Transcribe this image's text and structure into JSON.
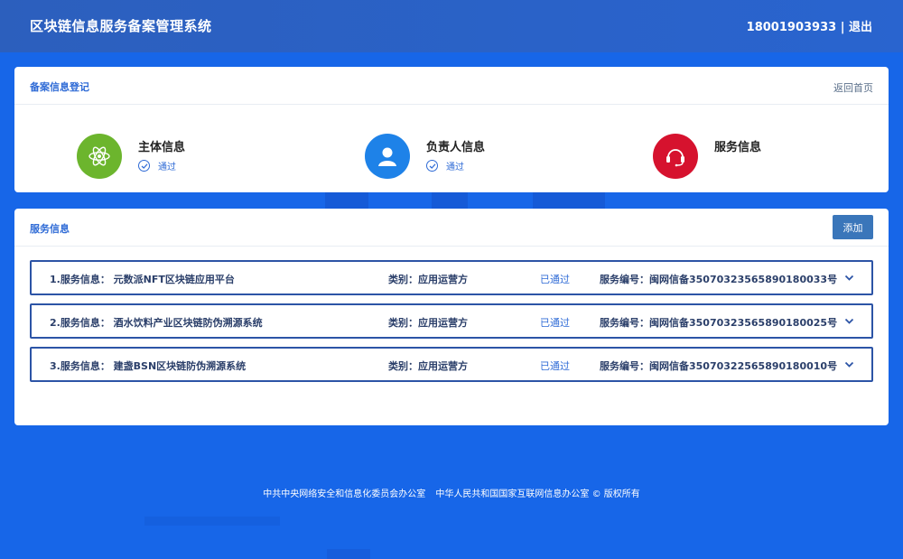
{
  "header": {
    "title": "区块链信息服务备案管理系统",
    "phone": "18001903933",
    "separator": "|",
    "logout": "退出"
  },
  "registration": {
    "title": "备案信息登记",
    "back_home": "返回首页",
    "steps": [
      {
        "name": "主体信息",
        "status": "通过",
        "icon": "atom-icon",
        "color": "#6cb52d"
      },
      {
        "name": "负责人信息",
        "status": "通过",
        "icon": "user-icon",
        "color": "#1e82e8"
      },
      {
        "name": "服务信息",
        "status": "",
        "icon": "headset-icon",
        "color": "#d6122e"
      }
    ]
  },
  "services": {
    "title": "服务信息",
    "add_label": "添加",
    "rows": [
      {
        "name": "1.服务信息： 元数派NFT区块链应用平台",
        "type": "类别：应用运营方",
        "status": "已通过",
        "number": "服务编号：闽网信备35070323565890180033号"
      },
      {
        "name": "2.服务信息： 酒水饮料产业区块链防伪溯源系统",
        "type": "类别：应用运营方",
        "status": "已通过",
        "number": "服务编号：闽网信备35070323565890180025号"
      },
      {
        "name": "3.服务信息： 建盏BSN区块链防伪溯源系统",
        "type": "类别：应用运营方",
        "status": "已通过",
        "number": "服务编号：闽网信备35070322565890180010号"
      }
    ]
  },
  "footer": {
    "org1": "中共中央网络安全和信息化委员会办公室",
    "org2": "中华人民共和国国家互联网信息办公室 © 版权所有"
  },
  "colors": {
    "background": "#1766e8",
    "header": "#2a62c8",
    "accent": "#2f6bd6",
    "row_border": "#2c54a6"
  }
}
